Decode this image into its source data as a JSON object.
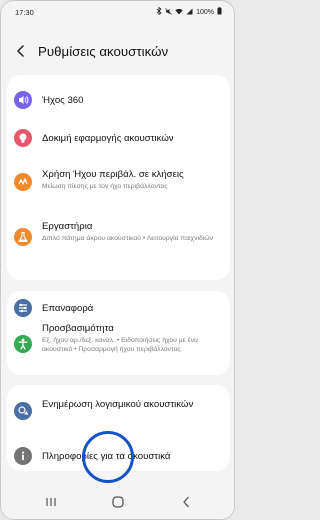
{
  "status_bar": {
    "time": "17:30",
    "battery": "100%"
  },
  "header": {
    "title": "Ρυθμίσεις ακουστικών"
  },
  "group1": [
    {
      "title": "Ήχος 360",
      "icon": "360-audio-icon",
      "color": "#7b63e8"
    },
    {
      "title": "Δοκιμή εφαρμογής ακουστικών",
      "icon": "earbud-fit-icon",
      "color": "#e8566c"
    },
    {
      "title": "Χρήση Ήχου περιβάλ. σε κλήσεις",
      "subtitle": "Μείωση πίεσης με τον ήχο περιβάλλοντος",
      "icon": "ambient-sound-icon",
      "color": "#f08a2c"
    },
    {
      "title": "Εργαστήρια",
      "subtitle": "Διπλό πάτημα άκρου ακουστικού • Λειτουργία παιχνιδιών",
      "icon": "labs-flask-icon",
      "color": "#f08a2c"
    }
  ],
  "group2": [
    {
      "title": "Επαναφορά",
      "icon": "reset-icon",
      "color": "#4a6fa5"
    },
    {
      "title": "Προσβασιμότητα",
      "subtitle": "Εξ. ήχου αρ./δεξ. καναλ. • Ειδοποιήσεις ήχου με ένα ακουστικό • Προσαρμογή ήχου περιβάλλοντος",
      "icon": "accessibility-icon",
      "color": "#34a853"
    }
  ],
  "group3": [
    {
      "title": "Ενημέρωση λογισμικού ακουστικών",
      "icon": "software-update-icon",
      "color": "#4a6fa5"
    },
    {
      "title": "Πληροφορίες για τα ακουστικά",
      "icon": "info-icon",
      "color": "#757575"
    }
  ],
  "nav": {
    "recent": "recent-apps-icon",
    "home": "home-icon",
    "back": "back-nav-icon"
  }
}
